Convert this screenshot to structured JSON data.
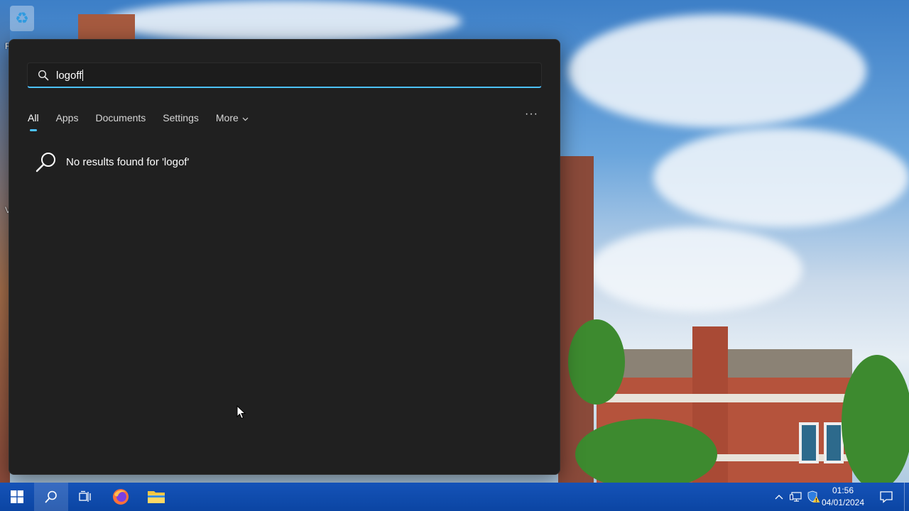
{
  "search": {
    "query": "logoff"
  },
  "tabs": [
    {
      "label": "All",
      "active": true
    },
    {
      "label": "Apps",
      "active": false
    },
    {
      "label": "Documents",
      "active": false
    },
    {
      "label": "Settings",
      "active": false
    },
    {
      "label": "More",
      "active": false
    }
  ],
  "more_options_label": "···",
  "results": {
    "message": "No results found for 'logof'"
  },
  "desktop": {
    "icon_letters": [
      "R",
      "V"
    ]
  },
  "taskbar": {
    "items": [
      {
        "name": "start-button",
        "icon": "windows-logo-icon"
      },
      {
        "name": "search-button",
        "icon": "search-icon"
      },
      {
        "name": "task-view-button",
        "icon": "task-view-icon"
      },
      {
        "name": "firefox-button",
        "icon": "firefox-icon"
      },
      {
        "name": "file-explorer-button",
        "icon": "folder-icon"
      }
    ],
    "clock": {
      "time": "01:56",
      "date": "04/01/2024"
    }
  },
  "colors": {
    "accent": "#4cc2ff",
    "panel_bg": "#202020",
    "taskbar_bg": "#0c47a1"
  }
}
